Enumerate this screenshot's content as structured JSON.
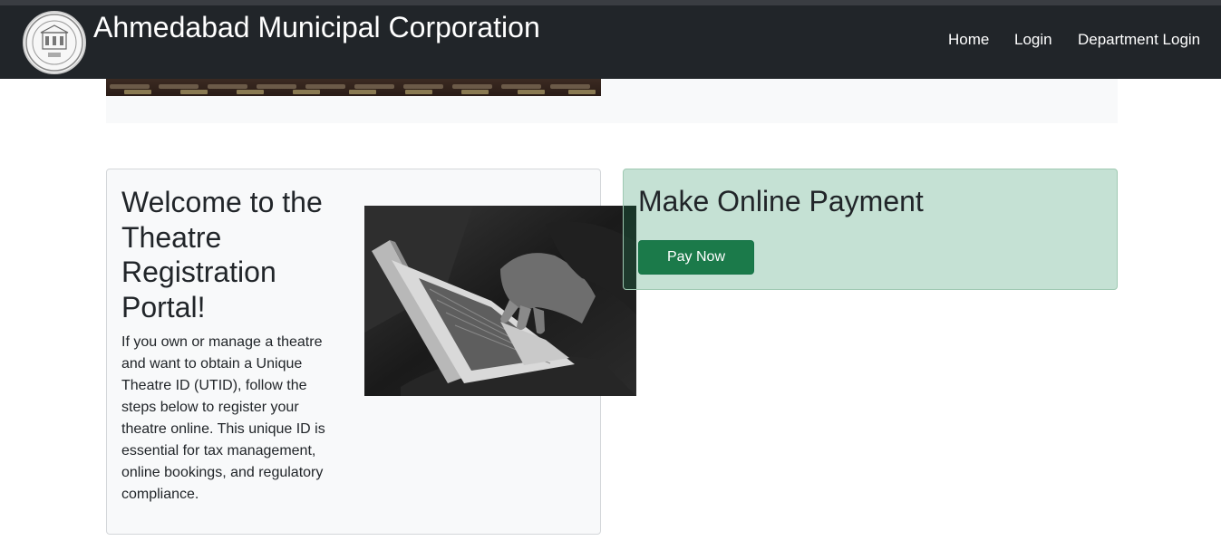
{
  "header": {
    "title": "Ahmedabad Municipal Corporation",
    "logo_icon": "amc-seal-logo",
    "nav": [
      {
        "label": "Home"
      },
      {
        "label": "Login"
      },
      {
        "label": "Department Login"
      }
    ]
  },
  "welcome": {
    "title": "Welcome to the Theatre Registration Portal!",
    "text": "If you own or manage a theatre and want to obtain a Unique Theatre ID (UTID), follow the steps below to register your theatre online. This unique ID is essential for tax management, online bookings, and regulatory compliance."
  },
  "payment": {
    "title": "Make Online Payment",
    "button_label": "Pay Now"
  },
  "colors": {
    "navbar": "#212529",
    "accent": "#198754",
    "payment_card": "#c5e1d4"
  }
}
